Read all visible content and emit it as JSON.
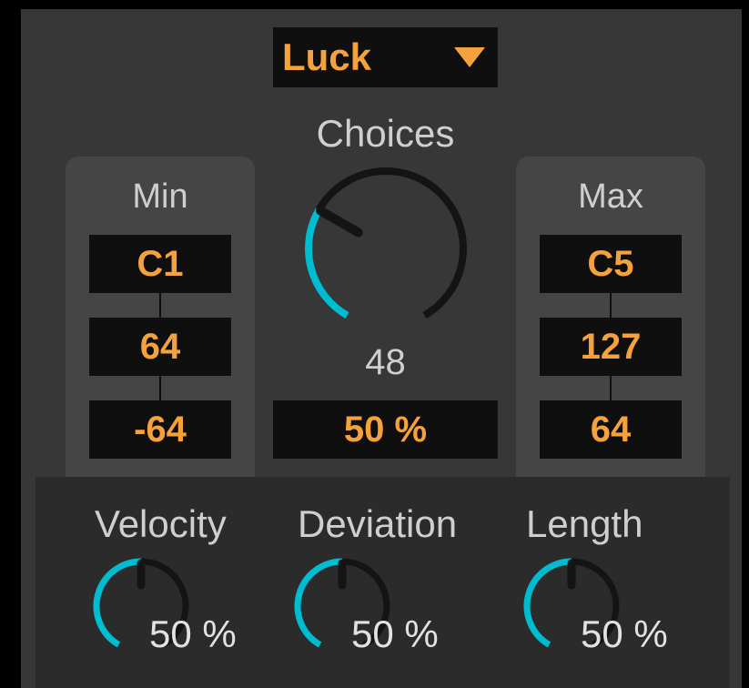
{
  "colors": {
    "accent": "#00bcd0",
    "value_text": "#f5a23c",
    "track": "#141414"
  },
  "selector": {
    "value": "Luck",
    "icon": "triangle-down-icon"
  },
  "choices": {
    "title": "Choices",
    "value": "48",
    "fraction": 0.3,
    "amount": "50 %"
  },
  "min": {
    "title": "Min",
    "note": "C1",
    "velocity": "64",
    "offset": "-64"
  },
  "max": {
    "title": "Max",
    "note": "C5",
    "velocity": "127",
    "offset": "64"
  },
  "knobs": [
    {
      "title": "Velocity",
      "value": "50 %",
      "fraction": 0.5
    },
    {
      "title": "Deviation",
      "value": "50 %",
      "fraction": 0.5
    },
    {
      "title": "Length",
      "value": "50 %",
      "fraction": 0.5
    }
  ]
}
